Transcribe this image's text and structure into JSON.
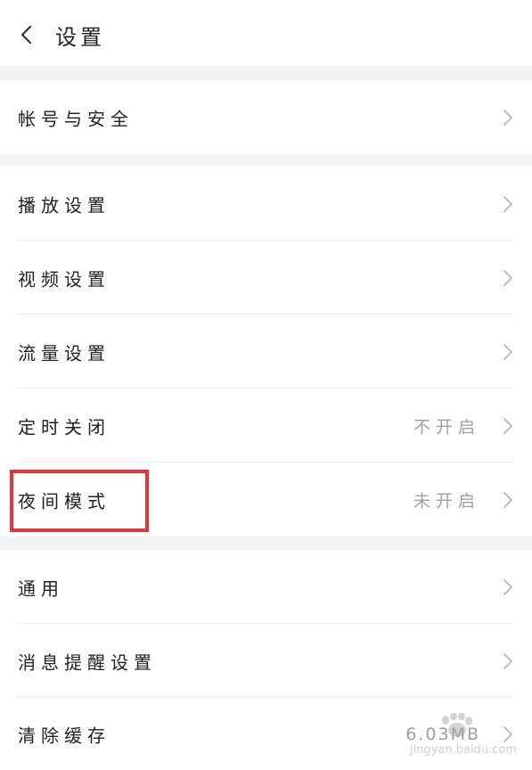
{
  "header": {
    "title": "设置"
  },
  "groups": [
    {
      "items": [
        {
          "label": "帐号与安全",
          "value": ""
        }
      ]
    },
    {
      "items": [
        {
          "label": "播放设置",
          "value": ""
        },
        {
          "label": "视频设置",
          "value": ""
        },
        {
          "label": "流量设置",
          "value": ""
        },
        {
          "label": "定时关闭",
          "value": "不开启"
        },
        {
          "label": "夜间模式",
          "value": "未开启"
        }
      ]
    },
    {
      "items": [
        {
          "label": "通用",
          "value": ""
        },
        {
          "label": "消息提醒设置",
          "value": ""
        },
        {
          "label": "清除缓存",
          "value": "6.03MB"
        }
      ]
    }
  ],
  "watermark": {
    "text": "jingyan.baidu.com"
  },
  "colors": {
    "highlight": "#e8323c",
    "band": "#f2f4f5",
    "value_text": "#a0a0a0"
  }
}
